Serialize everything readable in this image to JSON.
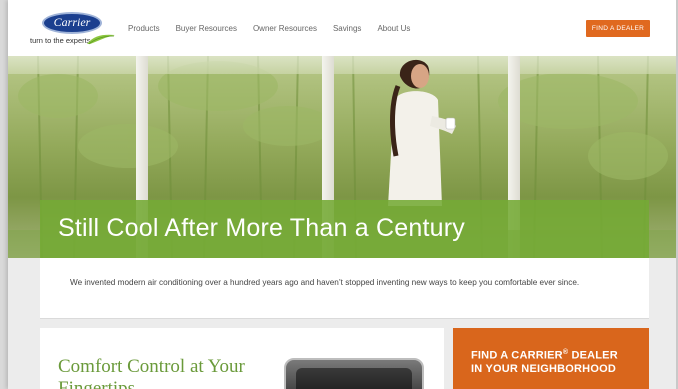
{
  "header": {
    "logo_word": "Carrier",
    "logo_tagline": "turn to the experts",
    "nav": [
      "Products",
      "Buyer Resources",
      "Owner Resources",
      "Savings",
      "About Us"
    ],
    "dealer_button": "FIND A DEALER"
  },
  "hero": {
    "title": "Still Cool After More Than a Century"
  },
  "intro": {
    "text": "We invented modern air conditioning over a hundred years ago and haven’t stopped inventing new ways to keep you comfortable ever since."
  },
  "comfort": {
    "title": "Comfort Control at Your Fingertips"
  },
  "find_panel": {
    "line1": "FIND A CARRIER",
    "reg": "®",
    "line1_end": " DEALER",
    "line2": "IN YOUR NEIGHBORHOOD"
  },
  "colors": {
    "accent_orange": "#e0691f",
    "brand_green": "#74aa34",
    "brand_blue": "#1b3f8f"
  }
}
